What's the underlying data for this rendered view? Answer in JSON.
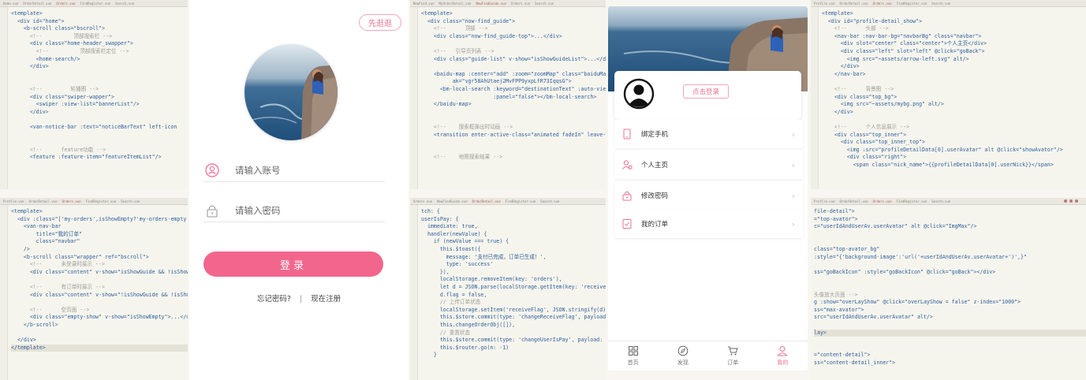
{
  "editor_tabs": {
    "p1": [
      "Home.vue",
      "OrderDetail.vue",
      "Orders.vue",
      "FindRegister.vue",
      "Search.vue"
    ],
    "p2": [
      "Profile.vue",
      "OrderDetail.vue",
      "Orders.vue",
      "FindRegister.vue",
      "Search.vue"
    ],
    "p3": [
      "NewFind.vue",
      "MyOrderDetail.vue",
      "NewFindGuide.vue",
      "Orders.vue",
      "Search.vue"
    ],
    "p4": [
      "Orders.vue",
      "NewFindGuide.vue",
      "OrderDetail.vue",
      "FindRegister.vue",
      "Search.vue"
    ],
    "p5": [
      "Profile.vue",
      "OrderDetail.vue",
      "Orders.vue",
      "FindRegister.vue",
      "Search.vue"
    ],
    "p6": [
      "Profile.vue",
      "OrderDetail.vue",
      "Orders.vue",
      "FindRegister.vue",
      "Search.vue"
    ]
  },
  "code": {
    "p1": [
      {
        "t": "<template>",
        "c": ""
      },
      {
        "t": "  <div id=\"home\">",
        "c": ""
      },
      {
        "t": "    <b-scroll class=\"bscroll\">",
        "c": ""
      },
      {
        "t": "      <!--          顶部搜索栏 -->",
        "c": "cm"
      },
      {
        "t": "      <div class=\"home-header_swapper\">",
        "c": ""
      },
      {
        "t": "        <!--          顶部搜索栏定位 -->",
        "c": "cm"
      },
      {
        "t": "        <home-search/>",
        "c": ""
      },
      {
        "t": "      </div>",
        "c": ""
      },
      {
        "t": "",
        "c": ""
      },
      {
        "t": "",
        "c": ""
      },
      {
        "t": "      <!--         轮播图 -->",
        "c": "cm"
      },
      {
        "t": "      <div class=\"swiper-wapper\">",
        "c": ""
      },
      {
        "t": "        <swiper :view-list=\"bannerList\"/>",
        "c": ""
      },
      {
        "t": "      </div>",
        "c": ""
      },
      {
        "t": "",
        "c": ""
      },
      {
        "t": "      <van-notice-bar :text=\"noticeBarText\" left-icon",
        "c": ""
      },
      {
        "t": "",
        "c": ""
      },
      {
        "t": "",
        "c": ""
      },
      {
        "t": "      <!--      feature功能 -->",
        "c": "cm"
      },
      {
        "t": "      <feature :feature-item=\"featureItemList\"/>",
        "c": ""
      }
    ],
    "p2": [
      {
        "t": "<template>",
        "c": ""
      },
      {
        "t": "  <div :class=\"['my-orders',isShowEmpty?'my-orders-empty':''",
        "c": ""
      },
      {
        "t": "    <van-nav-bar",
        "c": ""
      },
      {
        "t": "        title=\"我的订单\"",
        "c": ""
      },
      {
        "t": "        class=\"navbar\"",
        "c": ""
      },
      {
        "t": "    />",
        "c": ""
      },
      {
        "t": "    <b-scroll class=\"wrapper\" ref=\"bscroll\">",
        "c": ""
      },
      {
        "t": "      <!--      未登录时展示 -->",
        "c": "cm"
      },
      {
        "t": "      <div class=\"content\" v-show=\"isShowGuide && !isShowE",
        "c": ""
      },
      {
        "t": "",
        "c": ""
      },
      {
        "t": "      <!--      有订单时展示 -->",
        "c": "cm"
      },
      {
        "t": "      <div class=\"content\" v-show=\"!isShowGuide && !isShowE",
        "c": ""
      },
      {
        "t": "",
        "c": ""
      },
      {
        "t": "      <!--      空页面 -->",
        "c": "cm"
      },
      {
        "t": "      <div class=\"empty-show\" v-show=\"isShowEmpty\">...</div>",
        "c": ""
      },
      {
        "t": "    </b-scroll>",
        "c": ""
      },
      {
        "t": "",
        "c": ""
      },
      {
        "t": "  </div>",
        "c": ""
      },
      {
        "t": "</template>",
        "c": "hl"
      }
    ],
    "p3": [
      {
        "t": "<template>",
        "c": ""
      },
      {
        "t": "  <div class=\"now-find_guide\">",
        "c": ""
      },
      {
        "t": "    <!--      顶部 -->",
        "c": "cm"
      },
      {
        "t": "    <div class=\"now-find_guide-top\">...</div>",
        "c": ""
      },
      {
        "t": "",
        "c": ""
      },
      {
        "t": "    <!--   引导页列表 -->",
        "c": "cm"
      },
      {
        "t": "    <div class=\"guide-list\" v-show=\"isShowGuideList\">...</div>",
        "c": ""
      },
      {
        "t": "",
        "c": ""
      },
      {
        "t": "    <baidu-map :center=\"add\" :zoom=\"zoomMap\" class=\"baiduMap",
        "c": ""
      },
      {
        "t": "          ak=\"vgr58AhUtaej2MvFPP9yxpLfR73IqqsG\">",
        "c": ""
      },
      {
        "t": "      <bm-local-search :keyword=\"destinationText\" :auto-view",
        "c": ""
      },
      {
        "t": "                       :panel=\"false\"></bm-local-search>",
        "c": ""
      },
      {
        "t": "    </baidu-map>",
        "c": ""
      },
      {
        "t": "",
        "c": ""
      },
      {
        "t": "",
        "c": ""
      },
      {
        "t": "    <!--    搜索框弹出时动画 -->",
        "c": "cm"
      },
      {
        "t": "    <transition enter-active-class=\"animated fadeIn\" leave-a",
        "c": ""
      },
      {
        "t": "",
        "c": ""
      },
      {
        "t": "",
        "c": ""
      },
      {
        "t": "    <!--    地图搜索结果 -->",
        "c": "cm"
      }
    ],
    "p4": [
      {
        "t": "tch: {",
        "c": ""
      },
      {
        "t": "userIsPay: {",
        "c": ""
      },
      {
        "t": "  immediate: true,",
        "c": ""
      },
      {
        "t": "  handler(newValue) {",
        "c": ""
      },
      {
        "t": "    if (newValue === true) {",
        "c": ""
      },
      {
        "t": "      this.$toast({",
        "c": ""
      },
      {
        "t": "        message: '支付已完成，订单已生成！',",
        "c": ""
      },
      {
        "t": "        type: 'success'",
        "c": ""
      },
      {
        "t": "      }),",
        "c": ""
      },
      {
        "t": "      localStorage.removeItem(key: 'orders'),",
        "c": ""
      },
      {
        "t": "      let d = JSON.parse(localStorage.getItem(key: 'receiveFlag')),",
        "c": ""
      },
      {
        "t": "      d.flag = false,",
        "c": ""
      },
      {
        "t": "      // 上传订单状态",
        "c": "cm"
      },
      {
        "t": "      localStorage.setItem('receiveFlag', JSON.stringify(d)),",
        "c": ""
      },
      {
        "t": "      this.$store.commit(type: 'changeReceiveFlag', payload: false),",
        "c": ""
      },
      {
        "t": "      this.changeOrderObj([]),",
        "c": ""
      },
      {
        "t": "      // 重置状态",
        "c": "cm"
      },
      {
        "t": "      this.$store.commit(type: 'changeUserIsPay', payload: false),",
        "c": ""
      },
      {
        "t": "      this.$router.go(n: -1)",
        "c": ""
      },
      {
        "t": "    }",
        "c": ""
      }
    ],
    "p5": [
      {
        "t": "<template>",
        "c": ""
      },
      {
        "t": "  <div id=\"profile-detail_show\">",
        "c": ""
      },
      {
        "t": "    <!--      头部 -->",
        "c": "cm"
      },
      {
        "t": "    <nav-bar :nav-bar-bg=\"navbarBg\" class=\"navbar\">",
        "c": ""
      },
      {
        "t": "      <div slot=\"center\" class=\"center\">个人主页</div>",
        "c": ""
      },
      {
        "t": "      <div class=\"left\" slot=\"left\" @click=\"goBack\">",
        "c": ""
      },
      {
        "t": "        <img src=\"~assets/arrow-left.svg\" alt/>",
        "c": ""
      },
      {
        "t": "      </div>",
        "c": ""
      },
      {
        "t": "    </nav-bar>",
        "c": ""
      },
      {
        "t": "",
        "c": ""
      },
      {
        "t": "    <!--      背景图 -->",
        "c": "cm"
      },
      {
        "t": "    <div class=\"top_bg\">",
        "c": ""
      },
      {
        "t": "      <img src=\"~assets/mybg.png\" alt/>",
        "c": ""
      },
      {
        "t": "    </div>",
        "c": ""
      },
      {
        "t": "",
        "c": ""
      },
      {
        "t": "    <!--      个人信息展示 -->",
        "c": "cm"
      },
      {
        "t": "    <div class=\"top_inner\">",
        "c": ""
      },
      {
        "t": "      <div class=\"top_inner_top\">",
        "c": ""
      },
      {
        "t": "        <img :src=\"profileDetailData[0].userAvatar\" alt @click=\"showAvator\"/>",
        "c": ""
      },
      {
        "t": "        <div class=\"right\">",
        "c": ""
      },
      {
        "t": "          <span class=\"nick_name\">{{profileDetailData[0].userNick}}</span>",
        "c": ""
      }
    ],
    "p6": [
      {
        "t": "file-detail\">",
        "c": ""
      },
      {
        "t": "=\"top-avator\">",
        "c": ""
      },
      {
        "t": "c=\"userIdAndUserAv.userAvatar\" alt @click=\"ImgMax\"/>",
        "c": ""
      },
      {
        "t": "",
        "c": ""
      },
      {
        "t": "",
        "c": ""
      },
      {
        "t": "class=\"top-avator_bg\"",
        "c": ""
      },
      {
        "t": ":style=\"{'background-image':'url('+userIdAndUserAv.userAvatar+')',}\"",
        "c": ""
      },
      {
        "t": "",
        "c": ""
      },
      {
        "t": "ss=\"goBackIcon\" :style=\"goBackIcon\" @click=\"goBack\"></div>",
        "c": ""
      },
      {
        "t": "",
        "c": ""
      },
      {
        "t": "",
        "c": ""
      },
      {
        "t": "头像放大页面 -->",
        "c": "cm"
      },
      {
        "t": "g :show=\"overLayShow\" @click=\"overLayShow = false\" z-index=\"1000\">",
        "c": ""
      },
      {
        "t": "ss=\"max-avator\">",
        "c": ""
      },
      {
        "t": "src=\"userIdAndUserAv.userAvatar\" alt/>",
        "c": ""
      },
      {
        "t": "",
        "c": ""
      },
      {
        "t": "lay>",
        "c": "hl"
      },
      {
        "t": "",
        "c": ""
      },
      {
        "t": "",
        "c": ""
      },
      {
        "t": "=\"content-detail\">",
        "c": ""
      },
      {
        "t": "ss=\"content-detail_inner\">",
        "c": ""
      }
    ]
  },
  "login_screen": {
    "stroll_button": "先逛逛",
    "account_placeholder": "请输入账号",
    "password_placeholder": "请输入密码",
    "login_button": "登录",
    "forgot_password": "忘记密码?",
    "separator": "|",
    "register": "现在注册",
    "accent_color": "#f2668d"
  },
  "profile_screen": {
    "login_button": "点击登录",
    "menu": [
      {
        "label": "绑定手机",
        "icon": "phone-icon"
      },
      {
        "label": "个人主页",
        "icon": "person-icon"
      },
      {
        "label": "修改密码",
        "icon": "lock-icon"
      },
      {
        "label": "我的订单",
        "icon": "order-icon"
      }
    ],
    "chevron": "›",
    "tabs": [
      {
        "label": "首页",
        "icon": "home-grid-icon"
      },
      {
        "label": "发现",
        "icon": "compass-icon"
      },
      {
        "label": "订单",
        "icon": "cart-icon"
      },
      {
        "label": "我的",
        "icon": "user-icon"
      }
    ],
    "active_tab": "我的"
  }
}
